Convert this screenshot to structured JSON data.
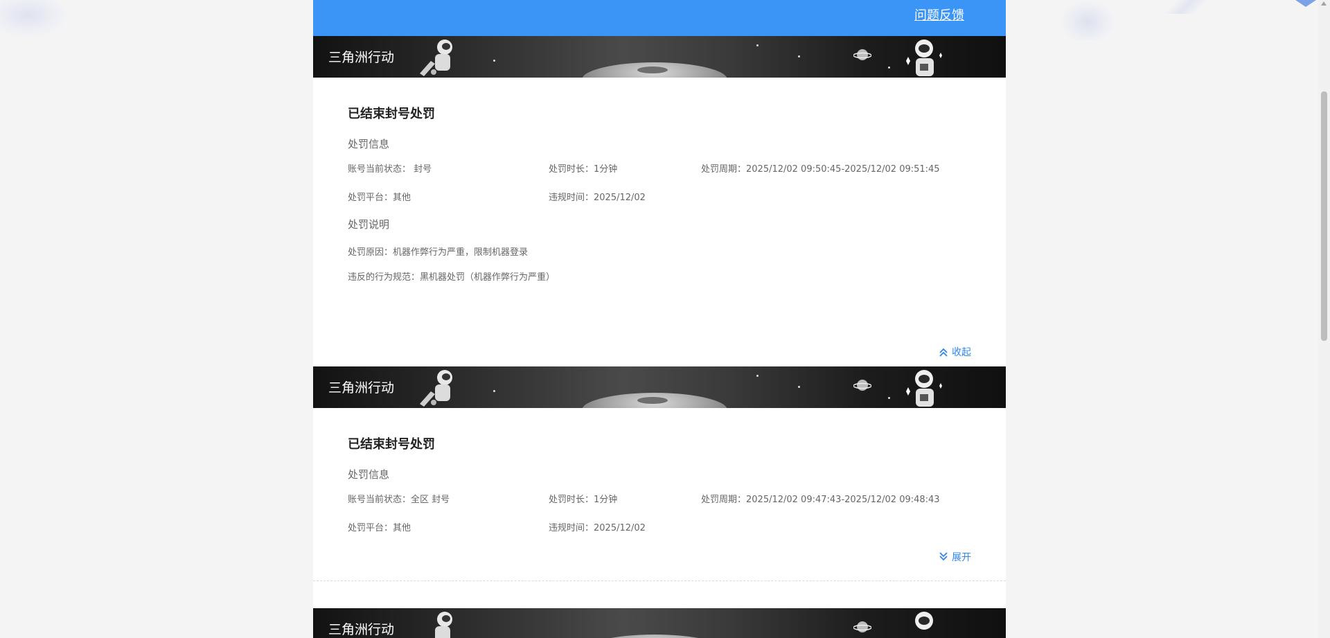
{
  "header": {
    "feedback_link": "问题反馈",
    "accent_color": "#3b95f7"
  },
  "cards": [
    {
      "banner_title": "三角洲行动",
      "title": "已结束封号处罚",
      "info_section": "处罚信息",
      "account_status": "账号当前状态： 封号",
      "duration": "处罚时长：1分钟",
      "period": "处罚周期：2025/12/02 09:50:45-2025/12/02 09:51:45",
      "platform": "处罚平台：其他",
      "violation_time": "违规时间：2025/12/02",
      "desc_section": "处罚说明",
      "reason": "处罚原因：机器作弊行为严重，限制机器登录",
      "rule": "违反的行为规范：黑机器处罚（机器作弊行为严重）",
      "toggle_label": "收起",
      "toggle_icon": "chevron-double-up-icon"
    },
    {
      "banner_title": "三角洲行动",
      "title": "已结束封号处罚",
      "info_section": "处罚信息",
      "account_status": "账号当前状态：全区 封号",
      "duration": "处罚时长：1分钟",
      "period": "处罚周期：2025/12/02 09:47:43-2025/12/02 09:48:43",
      "platform": "处罚平台：其他",
      "violation_time": "违规时间：2025/12/02",
      "toggle_label": "展开",
      "toggle_icon": "chevron-double-down-icon"
    },
    {
      "banner_title": "三角洲行动"
    }
  ]
}
